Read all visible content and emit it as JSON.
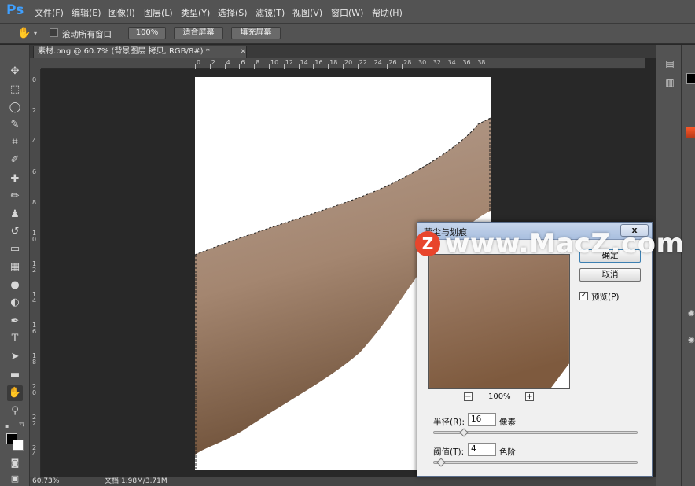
{
  "app": {
    "logo": "Ps"
  },
  "menu": [
    "文件(F)",
    "编辑(E)",
    "图像(I)",
    "图层(L)",
    "类型(Y)",
    "选择(S)",
    "滤镜(T)",
    "视图(V)",
    "窗口(W)",
    "帮助(H)"
  ],
  "options": {
    "tool_icon": "hand-icon",
    "scroll_all_label": "滚动所有窗口",
    "zoom_100_label": "100%",
    "fit_screen_label": "适合屏幕",
    "fill_screen_label": "填充屏幕"
  },
  "document_tab": {
    "title": "素材.png @ 60.7% (背景图层 拷贝, RGB/8#) *",
    "close": "×"
  },
  "ruler": {
    "top": [
      "0",
      "2",
      "4",
      "6",
      "8",
      "10",
      "12",
      "14",
      "16",
      "18",
      "20",
      "22",
      "24",
      "26",
      "28",
      "30",
      "32",
      "34",
      "36",
      "38"
    ],
    "left": [
      "0",
      "2",
      "4",
      "6",
      "8",
      "10",
      "12",
      "14",
      "16",
      "18",
      "20",
      "22",
      "24"
    ]
  },
  "status": {
    "zoom": "60.73%",
    "doc": "文档:1.98M/3.71M"
  },
  "dialog": {
    "title": "蒙尘与划痕",
    "close": "x",
    "ok_label": "确定",
    "cancel_label": "取消",
    "preview_label": "预览(P)",
    "preview_checked": true,
    "zoom_value": "100%",
    "zoom_out": "−",
    "zoom_in": "+",
    "radius_label": "半径(R):",
    "radius_value": "16",
    "radius_unit": "像素",
    "radius_slider": 0.08,
    "threshold_label": "阈值(T):",
    "threshold_value": "4",
    "threshold_unit": "色阶",
    "threshold_slider": 0.016
  },
  "watermark": {
    "logo": "Z",
    "text": "www.MacZ.com"
  },
  "colors": {
    "accent": "#3fa0ff",
    "skin": "#a78a73",
    "watermark_red": "#e8452c"
  }
}
